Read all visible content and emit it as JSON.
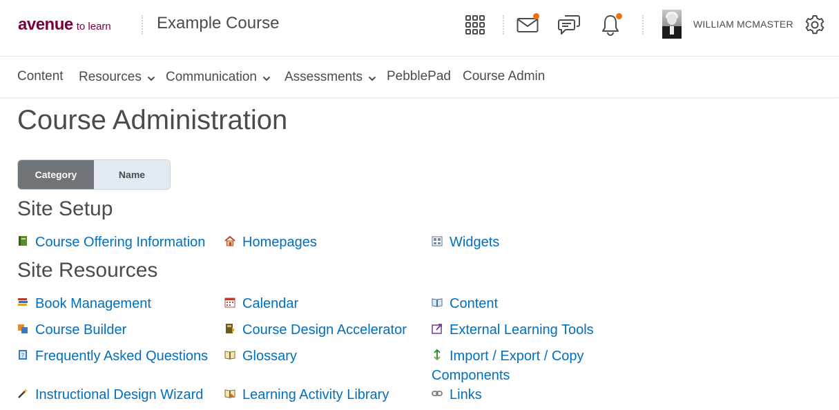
{
  "header": {
    "logo_main": "avenue",
    "logo_sub": "to learn",
    "course_title": "Example Course",
    "username": "WILLIAM MCMASTER",
    "accent": "#e87511",
    "brand": "#7a003c"
  },
  "nav": {
    "items": [
      {
        "label": "Content",
        "dropdown": false
      },
      {
        "label": "Resources",
        "dropdown": true
      },
      {
        "label": "Communication",
        "dropdown": true
      },
      {
        "label": "Assessments",
        "dropdown": true
      },
      {
        "label": "PebblePad",
        "dropdown": false
      },
      {
        "label": "Course Admin",
        "dropdown": false
      }
    ]
  },
  "page": {
    "title": "Course Administration",
    "toggle": {
      "category": "Category",
      "name": "Name",
      "selected": "Category"
    }
  },
  "sections": [
    {
      "title": "Site Setup",
      "links": [
        {
          "label": "Course Offering Information",
          "icon": "green-book-icon"
        },
        {
          "label": "Homepages",
          "icon": "house-icon"
        },
        {
          "label": "Widgets",
          "icon": "widgets-grid-icon"
        }
      ]
    },
    {
      "title": "Site Resources",
      "links": [
        {
          "label": "Book Management",
          "icon": "book-stack-icon"
        },
        {
          "label": "Calendar",
          "icon": "calendar-icon"
        },
        {
          "label": "Content",
          "icon": "open-book-icon"
        },
        {
          "label": "Course Builder",
          "icon": "course-builder-icon"
        },
        {
          "label": "Course Design Accelerator",
          "icon": "design-accelerator-icon"
        },
        {
          "label": "External Learning Tools",
          "icon": "external-tools-icon"
        },
        {
          "label": "Frequently Asked Questions",
          "icon": "faq-icon"
        },
        {
          "label": "Glossary",
          "icon": "glossary-icon"
        },
        {
          "label": "Import / Export / Copy Components",
          "label_line1": "Import / Export / Copy",
          "label_line2": "Components",
          "icon": "import-export-icon"
        },
        {
          "label": "Instructional Design Wizard",
          "icon": "magic-wand-icon"
        },
        {
          "label": "Learning Activity Library",
          "icon": "activity-library-icon"
        },
        {
          "label": "Links",
          "icon": "chain-link-icon"
        }
      ]
    }
  ]
}
